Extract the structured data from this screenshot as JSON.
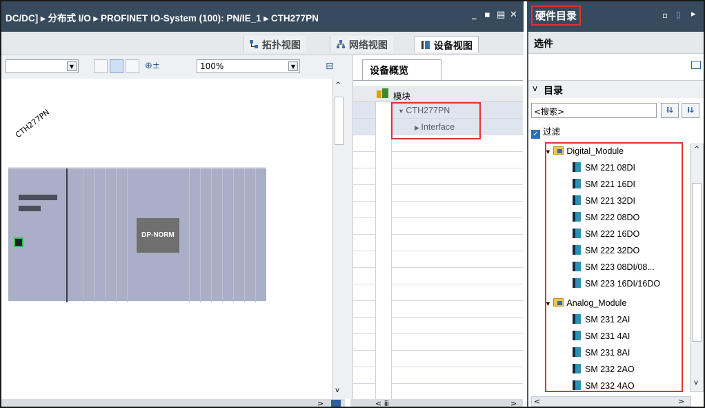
{
  "titlebar": {
    "breadcrumb": "DC/DC] ▸ 分布式 I/O ▸ PROFINET IO-System (100): PN/IE_1 ▸ CTH277PN",
    "win_buttons": [
      "_",
      "▪",
      "▤",
      "✕"
    ]
  },
  "hardware_catalog": {
    "title": "硬件目录",
    "options_header": "选件",
    "catalog_header": "目录",
    "search_placeholder": "<搜索>",
    "filter_label": "过滤",
    "filter_checked": true,
    "folders": [
      {
        "name": "Digital_Module",
        "items": [
          "SM 221 08DI",
          "SM 221 16DI",
          "SM 221 32DI",
          "SM 222 08DO",
          "SM 222 16DO",
          "SM 222 32DO",
          "SM 223 08DI/08...",
          "SM 223 16DI/16DO"
        ]
      },
      {
        "name": "Analog_Module",
        "items": [
          "SM 231 2AI",
          "SM 231 4AI",
          "SM 231 8AI",
          "SM 232 2AO",
          "SM 232 4AO"
        ]
      }
    ]
  },
  "view_tabs": [
    "拓扑视图",
    "网络视图",
    "设备视图"
  ],
  "active_view": "设备视图",
  "toolbar": {
    "zoom": "100%"
  },
  "canvas": {
    "device_name": "CTH277PN",
    "module_label": "DP-NORM"
  },
  "device_overview": {
    "tab_label": "设备概览",
    "column_header": "模块",
    "rows": [
      "CTH277PN",
      "Interface"
    ]
  },
  "colors": {
    "titlebar": "#374a5e",
    "highlight": "#e03333",
    "rack": "#a9afc6"
  }
}
